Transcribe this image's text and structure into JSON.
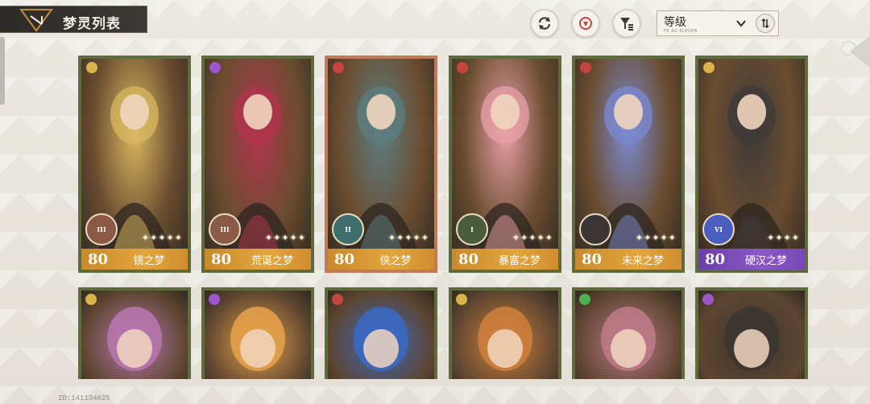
{
  "header": {
    "title": "梦灵列表"
  },
  "toolbar": {
    "sort_label": "等级",
    "sort_sub": "FE AG ELEVEB"
  },
  "cards_row1": [
    {
      "level": "80",
      "name": "镜之梦",
      "rank": "III",
      "stars": "✦✦✦✦✦",
      "frame": "green",
      "color": "#d8b860"
    },
    {
      "level": "80",
      "name": "荒诞之梦",
      "rank": "III",
      "stars": "✦✦✦✦✦",
      "frame": "green",
      "color": "#b0344d"
    },
    {
      "level": "80",
      "name": "侠之梦",
      "rank": "II",
      "stars": "✦✦✦✦✦",
      "frame": "orange",
      "color": "#5c7e82"
    },
    {
      "level": "80",
      "name": "暴富之梦",
      "rank": "I",
      "stars": "✦✦✦✦✦",
      "frame": "green",
      "color": "#e8a0a8"
    },
    {
      "level": "80",
      "name": "未来之梦",
      "rank": "",
      "stars": "✦✦✦✦✦",
      "frame": "green",
      "color": "#7a8ad0"
    },
    {
      "level": "80",
      "name": "硬汉之梦",
      "rank": "VI",
      "stars": "✦✦✦✦",
      "frame": "green",
      "color": "#3e3a38"
    }
  ],
  "cards_row2": [
    {
      "color": "#b878b0"
    },
    {
      "color": "#e7a24a"
    },
    {
      "color": "#3b6ac4"
    },
    {
      "color": "#d0803c"
    },
    {
      "color": "#c07a8a"
    },
    {
      "color": "#3b3530"
    }
  ],
  "footer": {
    "user_id": "ID:141134625"
  }
}
